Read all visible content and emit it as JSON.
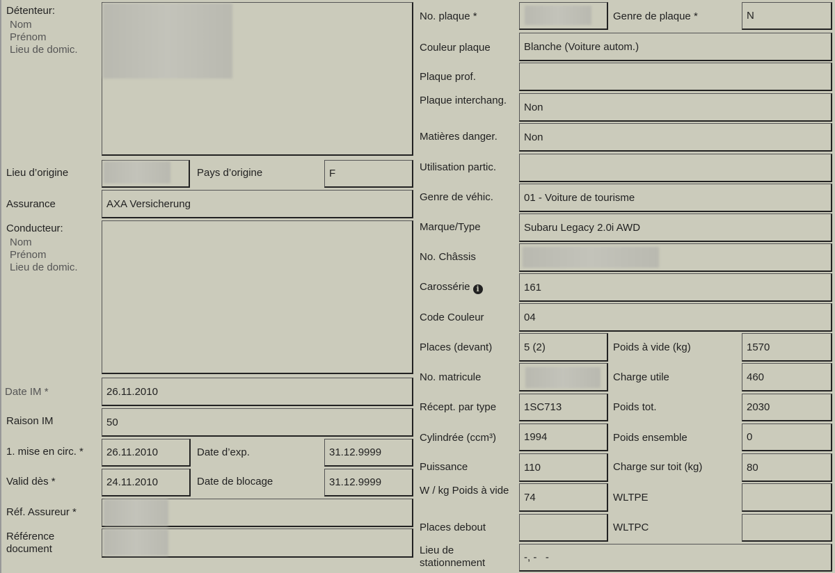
{
  "holder": {
    "label": "Détenteur:",
    "sub": [
      "Nom",
      "Prénom",
      "Lieu de domic."
    ]
  },
  "origin": {
    "label": "Lieu d’origine",
    "country_label": "Pays d’origine",
    "country_value": "F"
  },
  "insurance": {
    "label": "Assurance",
    "value": "AXA Versicherung"
  },
  "driver": {
    "label": "Conducteur:",
    "sub": [
      "Nom",
      "Prénom",
      "Lieu de domic."
    ]
  },
  "date_im": {
    "label": "Date IM",
    "star": "*",
    "value": "26.11.2010"
  },
  "raison_im": {
    "label": "Raison IM",
    "value": "50"
  },
  "first_circ": {
    "label": "1. mise en circ.",
    "star": "*",
    "value": "26.11.2010"
  },
  "date_exp": {
    "label": "Date d’exp.",
    "value": "31.12.9999"
  },
  "valid_des": {
    "label": "Valid dès",
    "star": "*",
    "value": "24.11.2010"
  },
  "date_blocage": {
    "label": "Date de blocage",
    "value": "31.12.9999"
  },
  "ref_assureur": {
    "label": "Réf. Assureur",
    "star": "*"
  },
  "ref_document": {
    "label": "Référence document"
  },
  "right": {
    "plate_no": {
      "label": "No. plaque",
      "star": "*"
    },
    "plate_kind": {
      "label": "Genre de plaque",
      "star": "*",
      "value": "N"
    },
    "plate_color": {
      "label": "Couleur plaque",
      "value": "Blanche (Voiture autom.)"
    },
    "plate_prof": {
      "label": "Plaque prof.",
      "value": ""
    },
    "plate_interchange": {
      "label": "Plaque interchang.",
      "value": "Non"
    },
    "dangerous": {
      "label": "Matières danger.",
      "value": "Non"
    },
    "usage": {
      "label": "Utilisation partic.",
      "value": ""
    },
    "vehicle_kind": {
      "label": "Genre de véhic.",
      "value": "01 - Voiture de tourisme"
    },
    "make": {
      "label": "Marque/Type",
      "value": "Subaru Legacy 2.0i AWD"
    },
    "chassis": {
      "label": "No. Châssis"
    },
    "body": {
      "label": "Carossérie",
      "value": "161"
    },
    "color_code": {
      "label": "Code Couleur",
      "value": "04"
    },
    "seats": {
      "label": "Places (devant)",
      "value": "5 (2)"
    },
    "empty_weight": {
      "label": "Poids à vide (kg)",
      "value": "1570"
    },
    "matricule": {
      "label": "No. matricule"
    },
    "payload": {
      "label": "Charge utile",
      "value": "460"
    },
    "type_approval": {
      "label": "Récept. par type",
      "value": "1SC713"
    },
    "total_weight": {
      "label": "Poids tot.",
      "value": "2030"
    },
    "displacement": {
      "label": "Cylindrée (ccm³)",
      "value": "1994"
    },
    "combo_weight": {
      "label": "Poids ensemble",
      "value": "0"
    },
    "power": {
      "label": "Puissance",
      "value": "110"
    },
    "roof_load": {
      "label": "Charge sur toit (kg)",
      "value": "80"
    },
    "w_per_kg": {
      "label": "W / kg Poids à vide",
      "value": "74"
    },
    "wltpe": {
      "label": "WLTPE",
      "value": ""
    },
    "standing": {
      "label": "Places debout",
      "value": ""
    },
    "wltpc": {
      "label": "WLTPC",
      "value": ""
    },
    "parking": {
      "label": "Lieu de stationnement",
      "value": "-, -   -"
    }
  },
  "icons": {
    "info": "info-circle-icon"
  }
}
